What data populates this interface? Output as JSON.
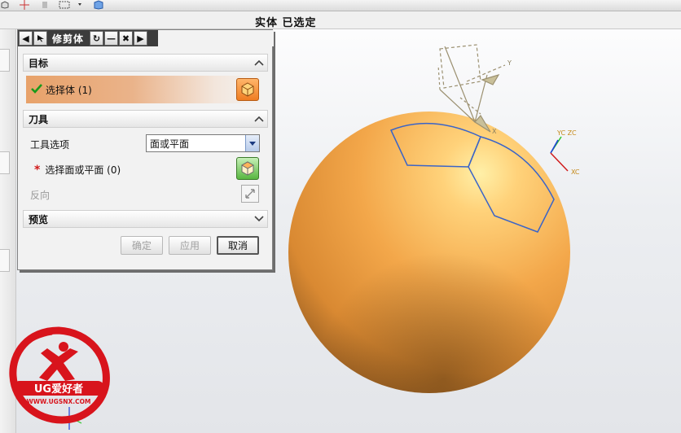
{
  "status_bar": {
    "text": "实体 已选定"
  },
  "dialog": {
    "title": "修剪体",
    "sections": {
      "target": {
        "label": "目标",
        "select_body_label": "选择体 (1)"
      },
      "tool": {
        "label": "刀具",
        "tool_option_label": "工具选项",
        "tool_option_value": "面或平面",
        "select_face_label": "选择面或平面 (0)",
        "reverse_label": "反向"
      },
      "preview": {
        "label": "预览"
      }
    },
    "buttons": {
      "ok": "确定",
      "apply": "应用",
      "cancel": "取消"
    }
  },
  "axes": {
    "wcs_y": "Y",
    "wcs_x": "X",
    "datum": {
      "yc_zc": "YC ZC",
      "xc": "XC"
    }
  },
  "logo": {
    "text": "UG爱好者",
    "url": "WWW.UGSNX.COM"
  },
  "colors": {
    "sphere": "#f0a545",
    "face_outline": "#3a64c8",
    "dialog_title_bg": "#3c3c3c",
    "select_row": "#e8a26a",
    "logo_red": "#d8141c"
  },
  "icons": {
    "check": "check-icon",
    "required": "asterisk-icon",
    "body_select": "cube-icon",
    "face_select": "face-cube-icon",
    "reverse": "reverse-direction-icon"
  }
}
